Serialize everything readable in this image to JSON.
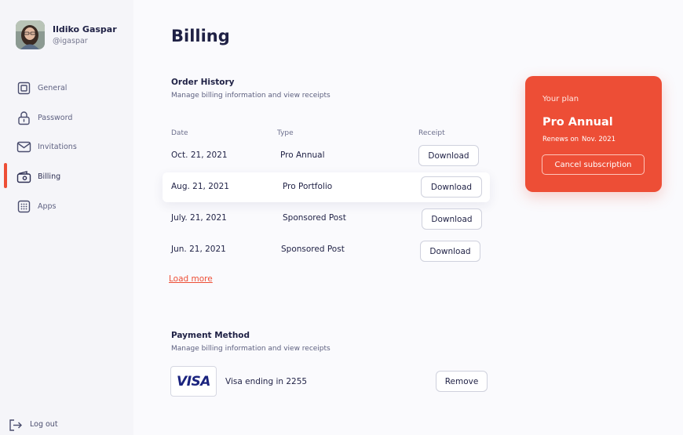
{
  "user": {
    "name": "Ildiko Gaspar",
    "handle": "@igaspar"
  },
  "nav": {
    "items": [
      {
        "label": "General",
        "icon": "square-icon"
      },
      {
        "label": "Password",
        "icon": "lock-icon"
      },
      {
        "label": "Invitations",
        "icon": "mail-icon"
      },
      {
        "label": "Billing",
        "icon": "wallet-icon"
      },
      {
        "label": "Apps",
        "icon": "grid-icon"
      }
    ],
    "active": "Billing",
    "logout": "Log out"
  },
  "page": {
    "title": "Billing"
  },
  "order_history": {
    "title": "Order History",
    "subtitle": "Manage billing information and view receipts",
    "columns": [
      "Date",
      "Type",
      "Receipt"
    ],
    "rows": [
      {
        "date": "Oct. 21, 2021",
        "type": "Pro Annual",
        "receipt": "Download"
      },
      {
        "date": "Aug. 21, 2021",
        "type": "Pro Portfolio",
        "receipt": "Download"
      },
      {
        "date": "July. 21, 2021",
        "type": "Sponsored Post",
        "receipt": "Download"
      },
      {
        "date": "Jun. 21, 2021",
        "type": "Sponsored Post",
        "receipt": "Download"
      }
    ],
    "load_more": "Load more"
  },
  "payment": {
    "title": "Payment Method",
    "subtitle": "Manage billing information and view receipts",
    "card_brand": "VISA",
    "card_label": "Visa ending in 2255",
    "remove_label": "Remove"
  },
  "plan": {
    "label": "Your plan",
    "name": "Pro Annual",
    "renews_prefix": "Renews on",
    "renews_date": "Nov. 2021",
    "cancel_label": "Cancel subscription"
  },
  "colors": {
    "accent": "#ed4e36",
    "text": "#1f2145",
    "visa": "#1a237e"
  }
}
